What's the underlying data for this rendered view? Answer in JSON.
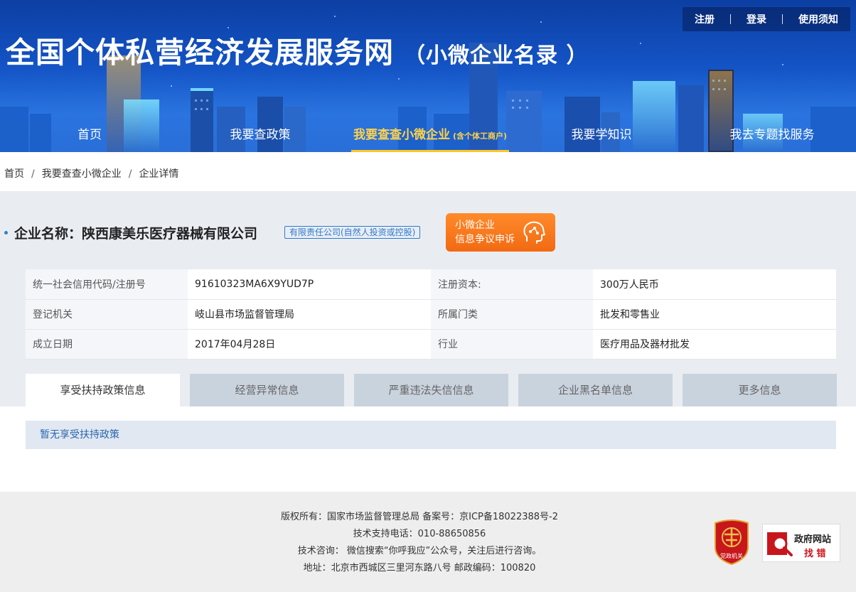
{
  "header": {
    "title": "全国个体私营经济发展服务网",
    "subtitle": "（小微企业名录 ）",
    "toplinks": [
      "注册",
      "登录",
      "使用须知"
    ]
  },
  "nav": {
    "items": [
      {
        "label": "首页",
        "small": ""
      },
      {
        "label": "我要查政策",
        "small": ""
      },
      {
        "label": "我要查查小微企业",
        "small": "(含个体工商户)"
      },
      {
        "label": "我要学知识",
        "small": ""
      },
      {
        "label": "我去专题找服务",
        "small": ""
      }
    ],
    "active_index": 2
  },
  "breadcrumb": [
    "首页",
    "我要查查小微企业",
    "企业详情"
  ],
  "company": {
    "label": "企业名称：",
    "name": "陕西康美乐医疗器械有限公司",
    "type": "有限责任公司(自然人投资或控股)",
    "dispute_line1": "小微企业",
    "dispute_line2": "信息争议申诉"
  },
  "info": {
    "rows": [
      {
        "k1": "统一社会信用代码/注册号",
        "v1": "91610323MA6X9YUD7P",
        "k2": "注册资本:",
        "v2": "300万人民币"
      },
      {
        "k1": "登记机关",
        "v1": "岐山县市场监督管理局",
        "k2": "所属门类",
        "v2": "批发和零售业"
      },
      {
        "k1": "成立日期",
        "v1": "2017年04月28日",
        "k2": "行业",
        "v2": "医疗用品及器材批发"
      }
    ]
  },
  "tabs": [
    "享受扶持政策信息",
    "经营异常信息",
    "严重违法失信信息",
    "企业黑名单信息",
    "更多信息"
  ],
  "policy_empty": "暂无享受扶持政策",
  "footer": {
    "line1": "版权所有：国家市场监督管理总局 备案号：京ICP备18022388号-2",
    "line2": "技术支持电话：010-88650856",
    "line3": "技术咨询： 微信搜索“你呼我应”公众号，关注后进行咨询。",
    "line4": "地址：北京市西城区三里河东路八号 邮政编码：100820",
    "party_badge": "党政机关",
    "gov_line1": "政府网站",
    "gov_line2": "找 错"
  },
  "colors": {
    "header_blue": "#1454c6",
    "active_nav": "#ffd24a",
    "dispute_orange": "#f26a12",
    "link_blue": "#2e7ad1",
    "party_red": "#c8161d"
  }
}
